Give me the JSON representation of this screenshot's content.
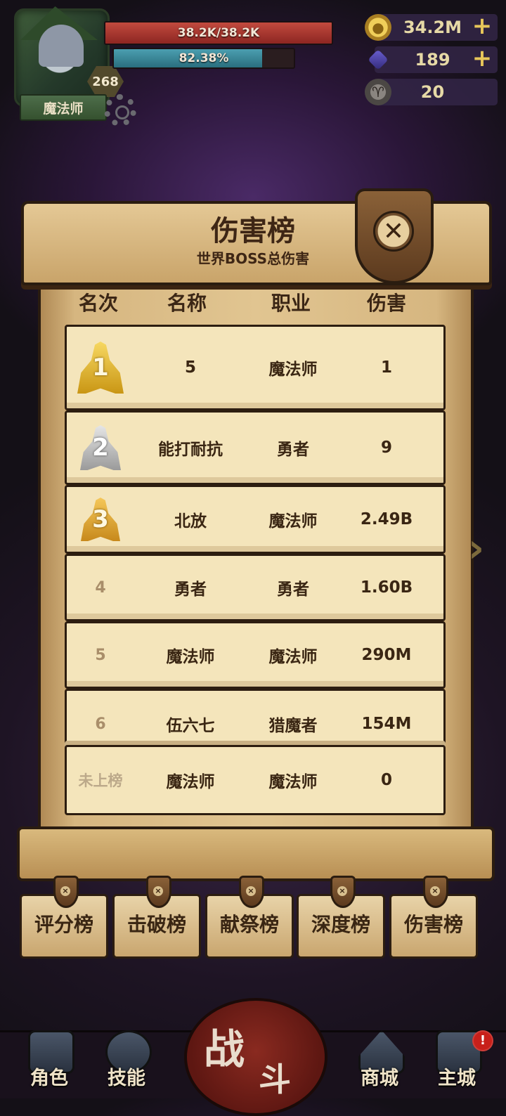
{
  "hud": {
    "hp_text": "38.2K/38.2K",
    "hp_fraction": 1.0,
    "exp_text": "82.38%",
    "exp_fraction": 0.8238,
    "level": "268",
    "class_name": "魔法师"
  },
  "resources": [
    {
      "icon": "coin-icon",
      "value": "34.2M",
      "has_plus": true
    },
    {
      "icon": "gem-icon",
      "value": "189",
      "has_plus": true
    },
    {
      "icon": "ram-skull-icon",
      "value": "20",
      "has_plus": false
    }
  ],
  "panel": {
    "title": "伤害榜",
    "subtitle": "世界BOSS总伤害",
    "headers": {
      "rank": "名次",
      "name": "名称",
      "class": "职业",
      "damage": "伤害"
    }
  },
  "rows": [
    {
      "rank": "1",
      "name": "5",
      "class": "魔法师",
      "damage": "1"
    },
    {
      "rank": "2",
      "name": "能打耐抗",
      "class": "勇者",
      "damage": "9"
    },
    {
      "rank": "3",
      "name": "北放",
      "class": "魔法师",
      "damage": "2.49B"
    },
    {
      "rank": "4",
      "name": "勇者",
      "class": "勇者",
      "damage": "1.60B"
    },
    {
      "rank": "5",
      "name": "魔法师",
      "class": "魔法师",
      "damage": "290M"
    },
    {
      "rank": "6",
      "name": "伍六七",
      "class": "猎魔者",
      "damage": "154M"
    }
  ],
  "self_row": {
    "rank": "未上榜",
    "name": "魔法师",
    "class": "魔法师",
    "damage": "0"
  },
  "tabs": [
    "评分榜",
    "击破榜",
    "献祭榜",
    "深度榜",
    "伤害榜"
  ],
  "nav": {
    "character": "角色",
    "skills": "技能",
    "battle_1": "战",
    "battle_2": "斗",
    "shop": "商城",
    "main_city": "主城",
    "alert": "!"
  },
  "colors": {
    "hp": "#b0302a",
    "exp": "#3a8a9c",
    "panel": "#e1c591",
    "row": "#f4e5bb"
  }
}
